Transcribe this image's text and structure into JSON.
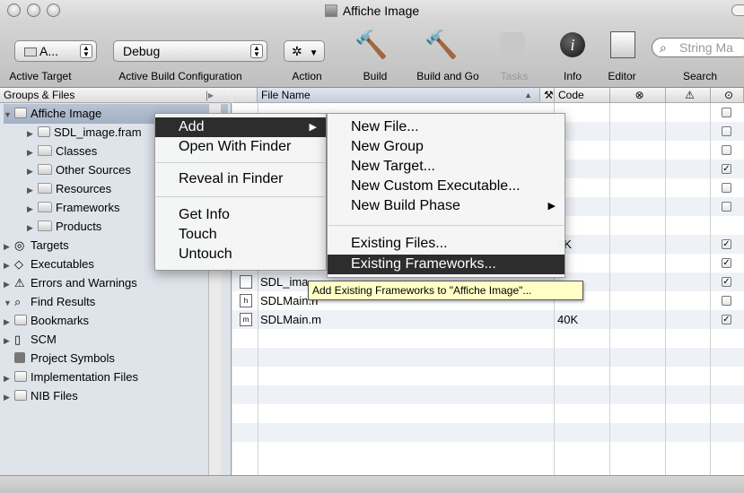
{
  "window": {
    "title": "Affiche Image"
  },
  "toolbar": {
    "target_popup": "A...",
    "config_popup": "Debug",
    "labels": {
      "active_target": "Active Target",
      "active_build_configuration": "Active Build Configuration",
      "action": "Action",
      "build": "Build",
      "build_and_go": "Build and Go",
      "tasks": "Tasks",
      "info": "Info",
      "editor": "Editor",
      "search": "Search"
    },
    "search_placeholder": "String Ma",
    "icons": {
      "build": "hammer-icon",
      "build_and_go": "hammer-run-icon",
      "tasks": "stop-sign-icon",
      "info": "info-icon",
      "editor": "editor-icon",
      "action": "gear-icon"
    }
  },
  "groups": {
    "header": "Groups & Files",
    "items": [
      {
        "label": "Affiche Image",
        "disclosure": "▼"
      },
      {
        "label": "SDL_image.fram",
        "disclosure": "▶"
      },
      {
        "label": "Classes",
        "disclosure": "▶"
      },
      {
        "label": "Other Sources",
        "disclosure": "▶"
      },
      {
        "label": "Resources",
        "disclosure": "▶"
      },
      {
        "label": "Frameworks",
        "disclosure": "▶"
      },
      {
        "label": "Products",
        "disclosure": "▶"
      },
      {
        "label": "Targets",
        "disclosure": "▶"
      },
      {
        "label": "Executables",
        "disclosure": "▶"
      },
      {
        "label": "Errors and Warnings",
        "disclosure": "▶"
      },
      {
        "label": "Find Results",
        "disclosure": "▼"
      },
      {
        "label": "Bookmarks",
        "disclosure": "▶"
      },
      {
        "label": "SCM",
        "disclosure": "▶"
      },
      {
        "label": "Project Symbols",
        "disclosure": ""
      },
      {
        "label": "Implementation Files",
        "disclosure": "▶"
      },
      {
        "label": "NIB Files",
        "disclosure": "▶"
      }
    ]
  },
  "file_list": {
    "columns": {
      "file_name": "File Name",
      "code": "Code",
      "errors": "⊗",
      "warnings": "⚠",
      "target": "⊙"
    },
    "rows": [
      {
        "name": "",
        "code": "",
        "checked": false
      },
      {
        "name": "",
        "code": "",
        "checked": false
      },
      {
        "name": "",
        "code": "",
        "checked": false
      },
      {
        "name": "",
        "code": "",
        "checked": true
      },
      {
        "name": "",
        "code": "",
        "checked": false
      },
      {
        "name": "",
        "code": "",
        "checked": false
      },
      {
        "name": "",
        "code": "",
        "checked": false
      },
      {
        "name": "",
        "code": "3K",
        "checked": true
      },
      {
        "name": "",
        "code": "",
        "checked": true
      },
      {
        "name": "SDL_ima",
        "code": "",
        "checked": true
      },
      {
        "name": "SDLMain.h",
        "code": "",
        "checked": false
      },
      {
        "name": "SDLMain.m",
        "code": "40K",
        "checked": true
      }
    ]
  },
  "context_menu": {
    "items": [
      "Add",
      "Open With Finder",
      "Reveal in Finder",
      "Get Info",
      "Touch",
      "Untouch"
    ]
  },
  "submenu": {
    "items": [
      "New File...",
      "New Group",
      "New Target...",
      "New Custom Executable...",
      "New Build Phase",
      "Existing Files...",
      "Existing Frameworks..."
    ]
  },
  "tooltip": "Add Existing Frameworks to \"Affiche Image\"..."
}
